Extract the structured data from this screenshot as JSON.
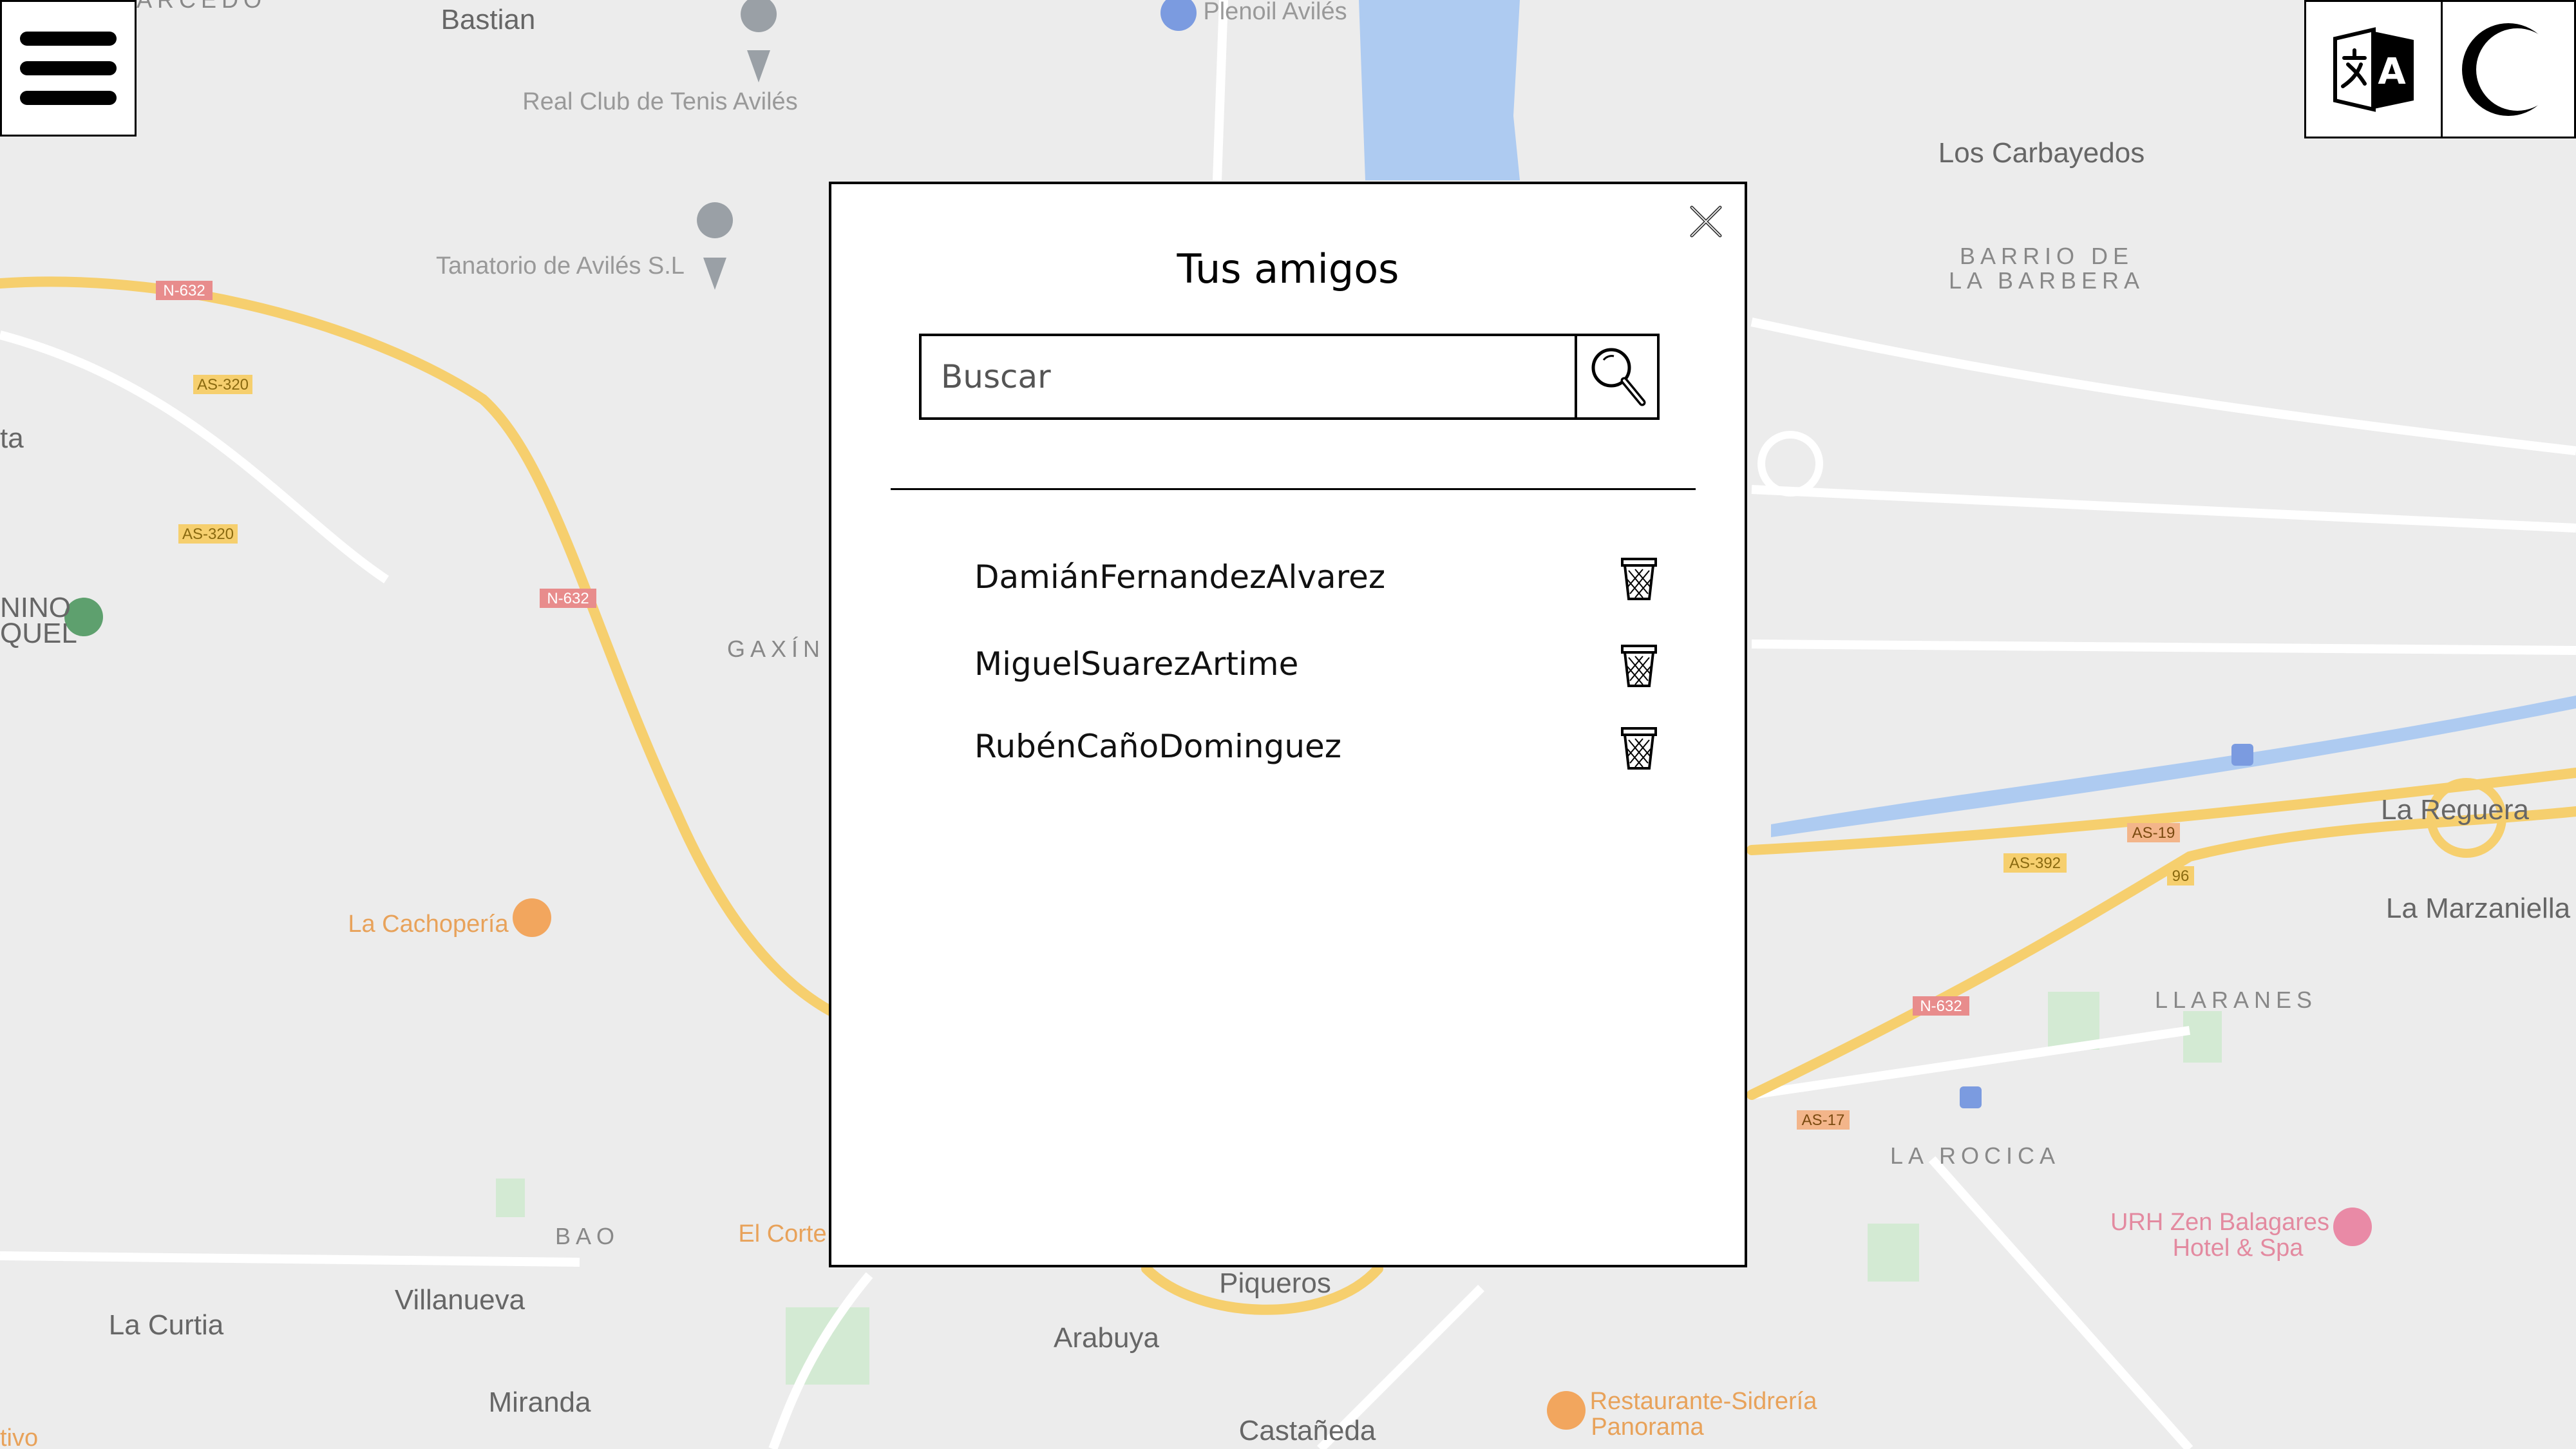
{
  "map": {
    "labels": [
      "Bastian",
      "Plenoil Avilés",
      "Real Club de Tenis Avilés",
      "Tanatorio de Avilés S.L",
      "Los Carbayedos",
      "BARRIO DE",
      "LA BARBERA",
      "GAXÍN",
      "La Cachopería",
      "BAO",
      "El Corte",
      "Villanueva",
      "La Curtia",
      "Miranda",
      "Piqueros",
      "Arabuya",
      "Castañeda",
      "La Reguera",
      "La Marzaniella",
      "LLARANES",
      "LA ROCICA",
      "URH Zen Balagares",
      "Hotel & Spa",
      "Restaurante-Sidrería",
      "Panorama",
      "ta",
      "NINO",
      "QUEL",
      "ARCEDO",
      "tivo"
    ],
    "road_codes": [
      "N-632",
      "AS-320",
      "AS-320",
      "N-632",
      "AS-19",
      "AS-392",
      "96",
      "N-632",
      "AS-17"
    ],
    "colors": {
      "background": "#ededed",
      "road": "#f6cf6e",
      "water": "#aecbf1",
      "park": "#cfe8cf"
    }
  },
  "toolbar": {
    "menu_icon": "hamburger-menu-icon",
    "language_icon": "translate-icon",
    "theme_icon": "dark-mode-moon-icon"
  },
  "modal": {
    "title": "Tus amigos",
    "search_placeholder": "Buscar",
    "search_icon": "magnifier-icon",
    "close_icon": "close-icon",
    "friends": [
      {
        "name": "DamiánFernandezAlvarez",
        "action_icon": "trash-icon"
      },
      {
        "name": "MiguelSuarezArtime",
        "action_icon": "trash-icon"
      },
      {
        "name": "RubénCañoDominguez",
        "action_icon": "trash-icon"
      }
    ]
  }
}
